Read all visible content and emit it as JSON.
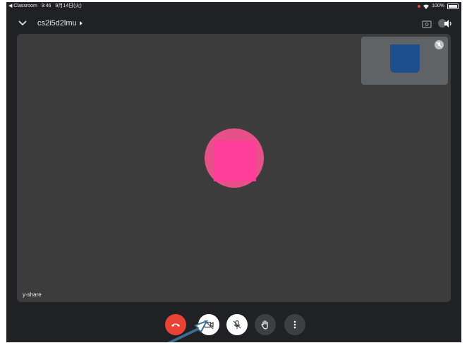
{
  "status_bar": {
    "back_app": "◀ Classroom",
    "time": "9:46",
    "date": "9月14日(火)",
    "battery": "100%"
  },
  "header": {
    "meeting_code": "cs2i5d2lmu"
  },
  "stage": {
    "participant_name": "y-share"
  },
  "colors": {
    "background": "#202124",
    "stage": "#3c3c3c",
    "end_call": "#ea4335",
    "avatar_main": "#e8508a",
    "avatar_self": "#1d4f8f",
    "annotation_arrow": "#3a6f8f"
  },
  "icons": {
    "collapse": "chevron-down-icon",
    "camera_switch": "camera-switch-icon",
    "speaker": "speaker-icon",
    "end_call": "phone-hangup-icon",
    "camera": "camera-off-icon",
    "mic": "mic-off-icon",
    "hand": "raise-hand-icon",
    "more": "more-vert-icon"
  }
}
